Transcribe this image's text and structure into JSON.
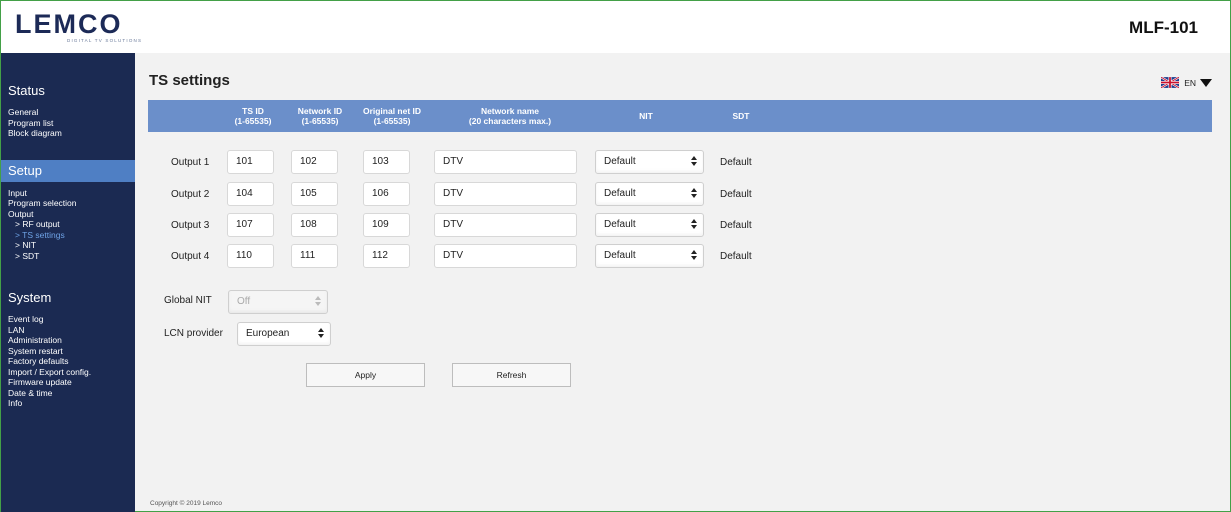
{
  "brand": {
    "logo": "LEMCO",
    "tagline": "DIGITAL TV SOLUTIONS",
    "model": "MLF-101"
  },
  "sidebar": {
    "status": {
      "title": "Status",
      "items": [
        "General",
        "Program list",
        "Block diagram"
      ]
    },
    "setup": {
      "title": "Setup",
      "items": [
        "Input",
        "Program selection",
        "Output"
      ],
      "subitems": [
        "> RF output",
        "> TS settings",
        "> NIT",
        "> SDT"
      ]
    },
    "system": {
      "title": "System",
      "items": [
        "Event log",
        "LAN",
        "Administration",
        "System restart",
        "Factory defaults",
        "Import / Export config.",
        "Firmware update",
        "Date & time",
        "Info"
      ]
    }
  },
  "page": {
    "title": "TS settings",
    "language": "EN"
  },
  "table": {
    "headers": {
      "ts_id": "TS ID",
      "ts_id_range": "(1-65535)",
      "network_id": "Network ID",
      "network_id_range": "(1-65535)",
      "orig_net_id": "Original net ID",
      "orig_net_id_range": "(1-65535)",
      "network_name": "Network name",
      "network_name_hint": "(20 characters max.)",
      "nit": "NIT",
      "sdt": "SDT"
    },
    "rows": [
      {
        "label": "Output 1",
        "ts_id": "101",
        "network_id": "102",
        "orig_net_id": "103",
        "network_name": "DTV",
        "nit": "Default",
        "sdt": "Default"
      },
      {
        "label": "Output 2",
        "ts_id": "104",
        "network_id": "105",
        "orig_net_id": "106",
        "network_name": "DTV",
        "nit": "Default",
        "sdt": "Default"
      },
      {
        "label": "Output 3",
        "ts_id": "107",
        "network_id": "108",
        "orig_net_id": "109",
        "network_name": "DTV",
        "nit": "Default",
        "sdt": "Default"
      },
      {
        "label": "Output 4",
        "ts_id": "110",
        "network_id": "111",
        "orig_net_id": "112",
        "network_name": "DTV",
        "nit": "Default",
        "sdt": "Default"
      }
    ]
  },
  "global_nit": {
    "label": "Global NIT",
    "value": "Off"
  },
  "lcn_provider": {
    "label": "LCN provider",
    "value": "European"
  },
  "buttons": {
    "apply": "Apply",
    "refresh": "Refresh"
  },
  "footer": {
    "copyright": "Copyright © 2019 Lemco"
  },
  "colors": {
    "sidebar_bg": "#1b2a52",
    "active_section": "#4f7fc4",
    "table_header": "#6b8fca",
    "current_item": "#6fa3e6"
  }
}
